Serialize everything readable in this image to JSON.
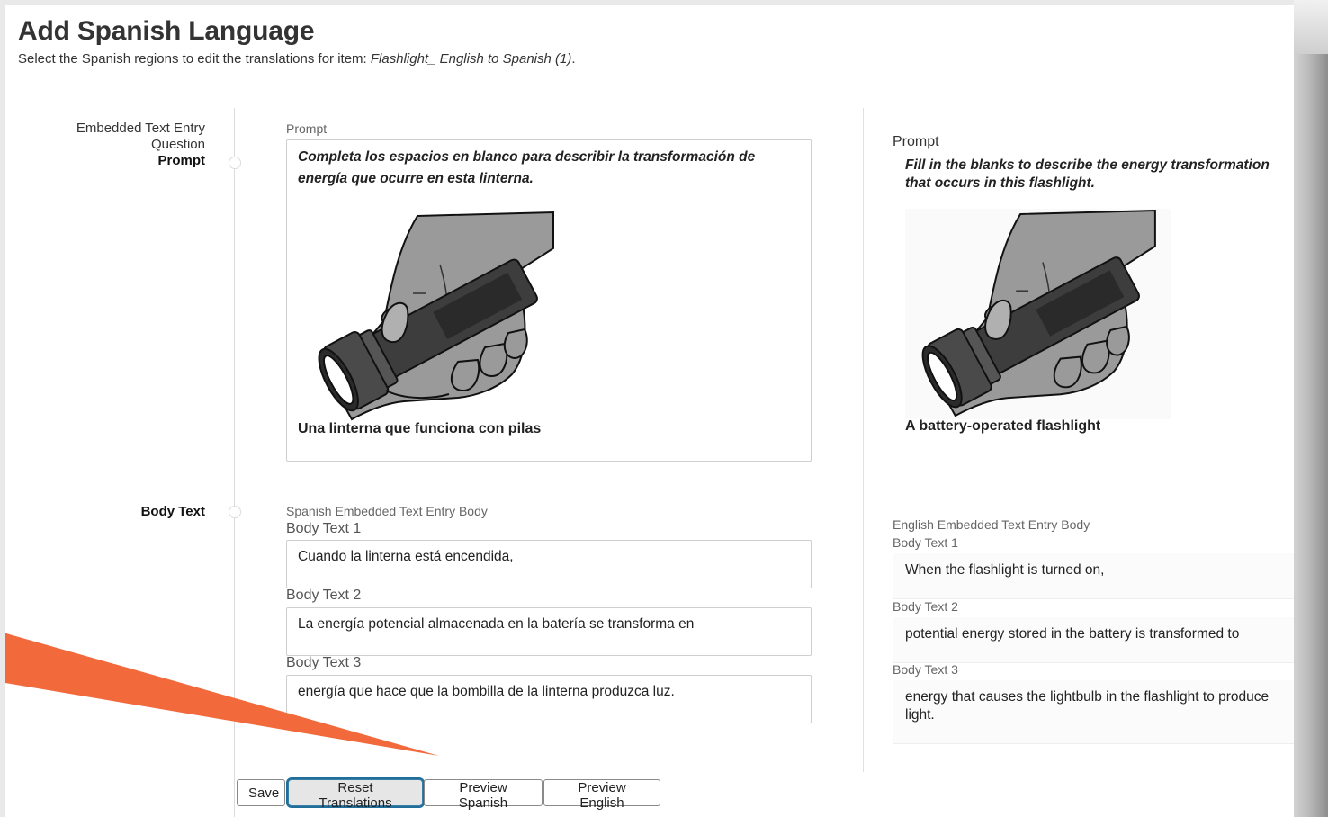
{
  "header": {
    "title": "Add Spanish Language",
    "subtitle_prefix": "Select the Spanish regions to edit the translations for item: ",
    "subtitle_item": "Flashlight_ English to Spanish (1)",
    "subtitle_suffix": "."
  },
  "sections": {
    "prompt": {
      "label_line1": "Embedded Text Entry",
      "label_line2": "Question",
      "label_bold": "Prompt"
    },
    "body": {
      "label_bold": "Body Text"
    }
  },
  "spanish": {
    "prompt_label": "Prompt",
    "prompt_text": "Completa los espacios en blanco para describir la transformación de energía que ocurre en esta linterna.",
    "caption": "Una linterna que funciona con pilas",
    "body_group_label": "Spanish Embedded Text Entry Body",
    "body": [
      {
        "label": "Body Text 1",
        "value": "Cuando la linterna está encendida,"
      },
      {
        "label": "Body Text 2",
        "value": "La energía potencial almacenada en la batería se transforma en"
      },
      {
        "label": "Body Text 3",
        "value": "energía que hace que la bombilla de la linterna produzca luz."
      }
    ]
  },
  "english": {
    "prompt_label": "Prompt",
    "prompt_text": "Fill in the blanks to describe the energy transformation that occurs in this flashlight.",
    "caption": "A battery-operated flashlight",
    "body_group_label": "English Embedded Text Entry Body",
    "body": [
      {
        "label": "Body Text 1",
        "value": "When the flashlight is turned on,"
      },
      {
        "label": "Body Text 2",
        "value": "potential energy stored in the battery is transformed to"
      },
      {
        "label": "Body Text 3",
        "value": "energy that causes the lightbulb in the flashlight to produce light."
      }
    ]
  },
  "buttons": {
    "save": "Save",
    "reset": "Reset Translations",
    "preview_spanish": "Preview Spanish",
    "preview_english": "Preview English"
  },
  "colors": {
    "accent_outline": "#1f6f9a",
    "annotation_arrow": "#f26a3c"
  }
}
